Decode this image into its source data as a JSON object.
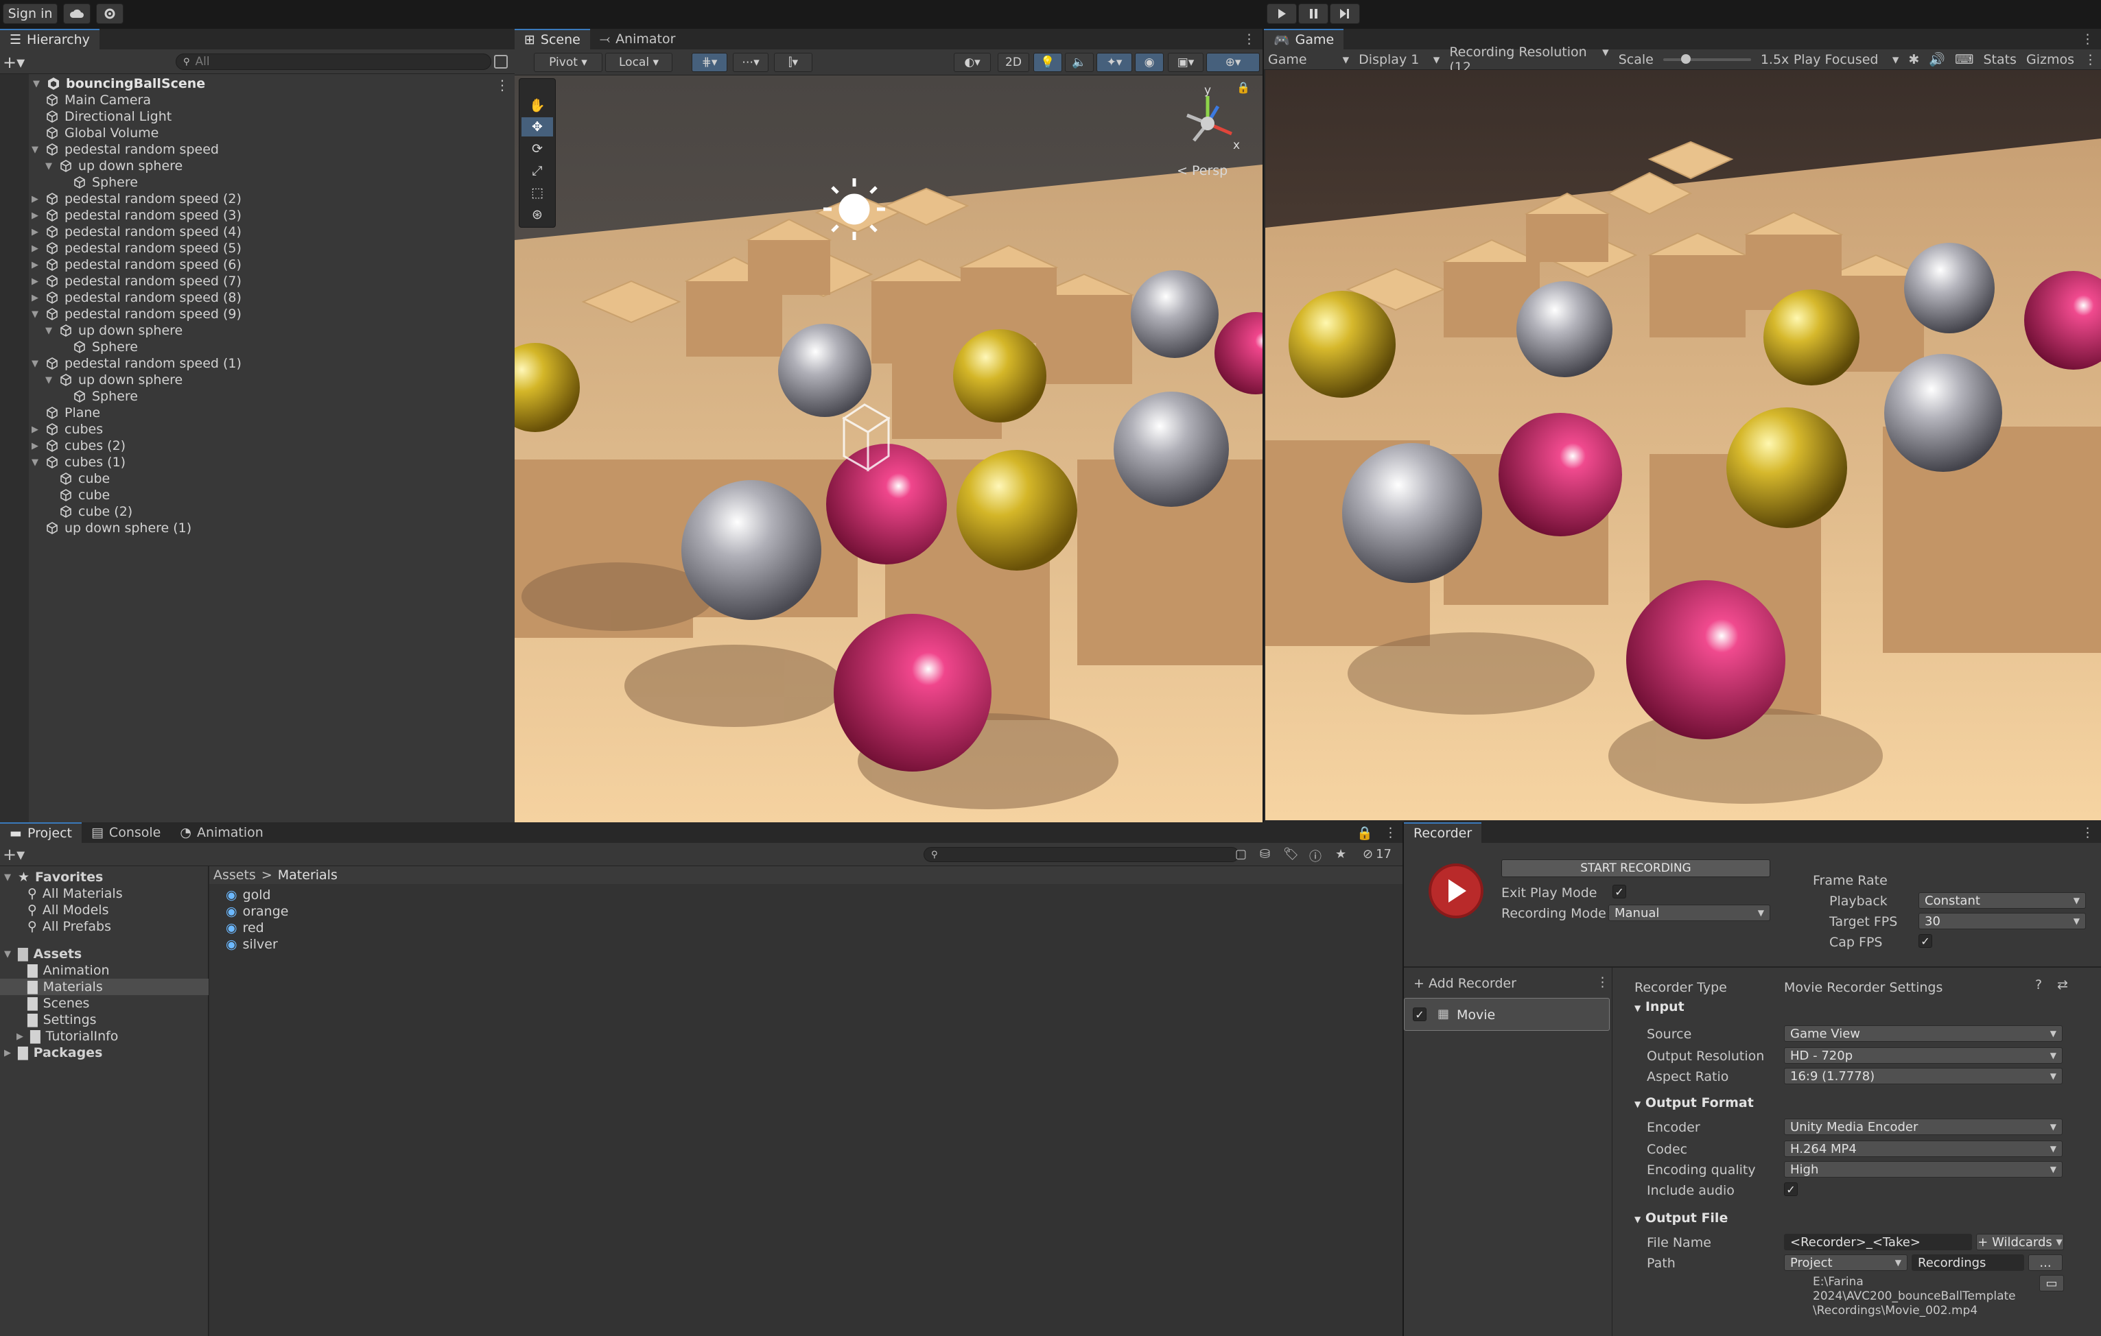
{
  "topbar": {
    "sign_in": "Sign in",
    "cloud_icon": "cloud-icon",
    "settings_icon": "gear-icon",
    "play_icon": "play-icon",
    "pause_icon": "pause-icon",
    "step_icon": "step-icon"
  },
  "hierarchy": {
    "tab": "Hierarchy",
    "search_placeholder": "All",
    "scene_name": "bouncingBallScene",
    "items": [
      {
        "label": "Main Camera",
        "depth": 1,
        "arrow": ""
      },
      {
        "label": "Directional Light",
        "depth": 1,
        "arrow": ""
      },
      {
        "label": "Global Volume",
        "depth": 1,
        "arrow": ""
      },
      {
        "label": "pedestal random speed",
        "depth": 1,
        "arrow": "open"
      },
      {
        "label": "up down sphere",
        "depth": 2,
        "arrow": "open"
      },
      {
        "label": "Sphere",
        "depth": 3,
        "arrow": ""
      },
      {
        "label": "pedestal random speed (2)",
        "depth": 1,
        "arrow": "closed"
      },
      {
        "label": "pedestal random speed (3)",
        "depth": 1,
        "arrow": "closed"
      },
      {
        "label": "pedestal random speed (4)",
        "depth": 1,
        "arrow": "closed"
      },
      {
        "label": "pedestal random speed (5)",
        "depth": 1,
        "arrow": "closed"
      },
      {
        "label": "pedestal random speed (6)",
        "depth": 1,
        "arrow": "closed"
      },
      {
        "label": "pedestal random speed (7)",
        "depth": 1,
        "arrow": "closed"
      },
      {
        "label": "pedestal random speed (8)",
        "depth": 1,
        "arrow": "closed"
      },
      {
        "label": "pedestal random speed (9)",
        "depth": 1,
        "arrow": "open"
      },
      {
        "label": "up down sphere",
        "depth": 2,
        "arrow": "open"
      },
      {
        "label": "Sphere",
        "depth": 3,
        "arrow": ""
      },
      {
        "label": "pedestal random speed (1)",
        "depth": 1,
        "arrow": "open"
      },
      {
        "label": "up down sphere",
        "depth": 2,
        "arrow": "open"
      },
      {
        "label": "Sphere",
        "depth": 3,
        "arrow": ""
      },
      {
        "label": "Plane",
        "depth": 1,
        "arrow": ""
      },
      {
        "label": "cubes",
        "depth": 1,
        "arrow": "closed"
      },
      {
        "label": "cubes (2)",
        "depth": 1,
        "arrow": "closed"
      },
      {
        "label": "cubes (1)",
        "depth": 1,
        "arrow": "open"
      },
      {
        "label": "cube",
        "depth": 2,
        "arrow": ""
      },
      {
        "label": "cube",
        "depth": 2,
        "arrow": ""
      },
      {
        "label": "cube (2)",
        "depth": 2,
        "arrow": ""
      },
      {
        "label": "up down sphere (1)",
        "depth": 1,
        "arrow": ""
      }
    ]
  },
  "scene": {
    "tab_scene": "Scene",
    "tab_animator": "Animator",
    "pivot": "Pivot",
    "local": "Local",
    "mode_2d": "2D",
    "persp": "Persp",
    "gizmo_y": "y",
    "gizmo_x": "x"
  },
  "game": {
    "tab": "Game",
    "view": "Game",
    "display": "Display 1",
    "resolution": "Recording Resolution (12",
    "scale_label": "Scale",
    "scale_value": "1.5x",
    "play_focused": "Play Focused",
    "stats": "Stats",
    "gizmos": "Gizmos"
  },
  "project": {
    "tab_project": "Project",
    "tab_console": "Console",
    "tab_animation": "Animation",
    "hidden_count": "17",
    "favorites": "Favorites",
    "fav_items": [
      "All Materials",
      "All Models",
      "All Prefabs"
    ],
    "assets": "Assets",
    "asset_folders": [
      "Animation",
      "Materials",
      "Scenes",
      "Settings",
      "TutorialInfo"
    ],
    "packages": "Packages",
    "breadcrumb_root": "Assets",
    "breadcrumb_sep": ">",
    "breadcrumb_current": "Materials",
    "materials": [
      "gold",
      "orange",
      "red",
      "silver"
    ]
  },
  "recorder": {
    "tab": "Recorder",
    "start": "START RECORDING",
    "exit_play_mode": "Exit Play Mode",
    "recording_mode_label": "Recording Mode",
    "recording_mode": "Manual",
    "frame_rate": "Frame Rate",
    "playback_label": "Playback",
    "playback": "Constant",
    "target_fps_label": "Target FPS",
    "target_fps": "30",
    "cap_fps": "Cap FPS",
    "add_recorder": "+ Add Recorder",
    "movie": "Movie",
    "recorder_type_label": "Recorder Type",
    "recorder_type": "Movie Recorder Settings",
    "input": "Input",
    "source_label": "Source",
    "source": "Game View",
    "output_res_label": "Output Resolution",
    "output_res": "HD - 720p",
    "aspect_label": "Aspect Ratio",
    "aspect": "16:9 (1.7778)",
    "output_format": "Output Format",
    "encoder_label": "Encoder",
    "encoder": "Unity Media Encoder",
    "codec_label": "Codec",
    "codec": "H.264 MP4",
    "quality_label": "Encoding quality",
    "quality": "High",
    "include_audio": "Include audio",
    "output_file": "Output File",
    "file_name_label": "File Name",
    "file_name": "<Recorder>_<Take>",
    "wildcards": "+ Wildcards",
    "path_label": "Path",
    "path_root": "Project",
    "path_folder": "Recordings",
    "path_more": "...",
    "full_path_1": "E:\\Farina",
    "full_path_2": "2024\\AVC200_bounceBallTemplate",
    "full_path_3": "\\Recordings\\Movie_002.mp4"
  }
}
